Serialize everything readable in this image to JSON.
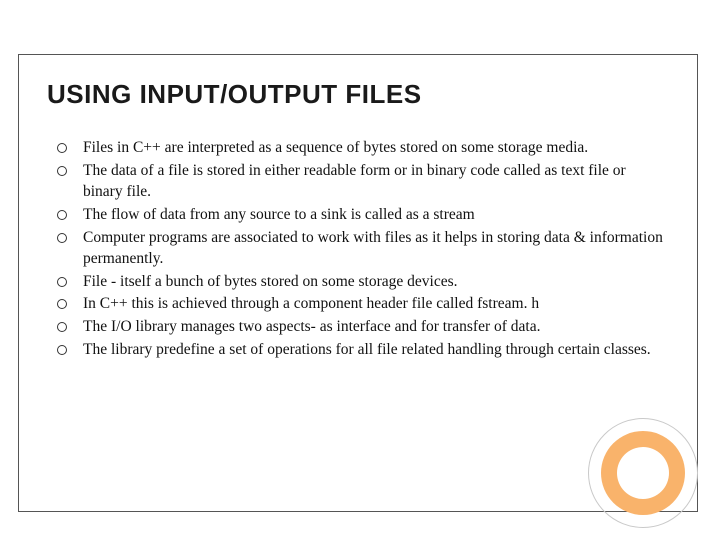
{
  "title": "USING INPUT/OUTPUT FILES",
  "bullets": [
    "Files in C++ are interpreted as a sequence of bytes stored on some storage media.",
    "The data of a file is stored in either readable form or in binary code called as text file or binary file.",
    "The flow of data from any source to a sink is called as a stream",
    "Computer programs are associated to work with files as it helps in storing data & information  permanently.",
    "File  - itself a bunch of bytes stored on some storage devices.",
    "In C++ this is achieved through a component header file called fstream. h",
    "The I/O library manages two aspects- as  interface and for  transfer of data.",
    "The library predefine a set of operations for all file related handling through certain classes."
  ]
}
